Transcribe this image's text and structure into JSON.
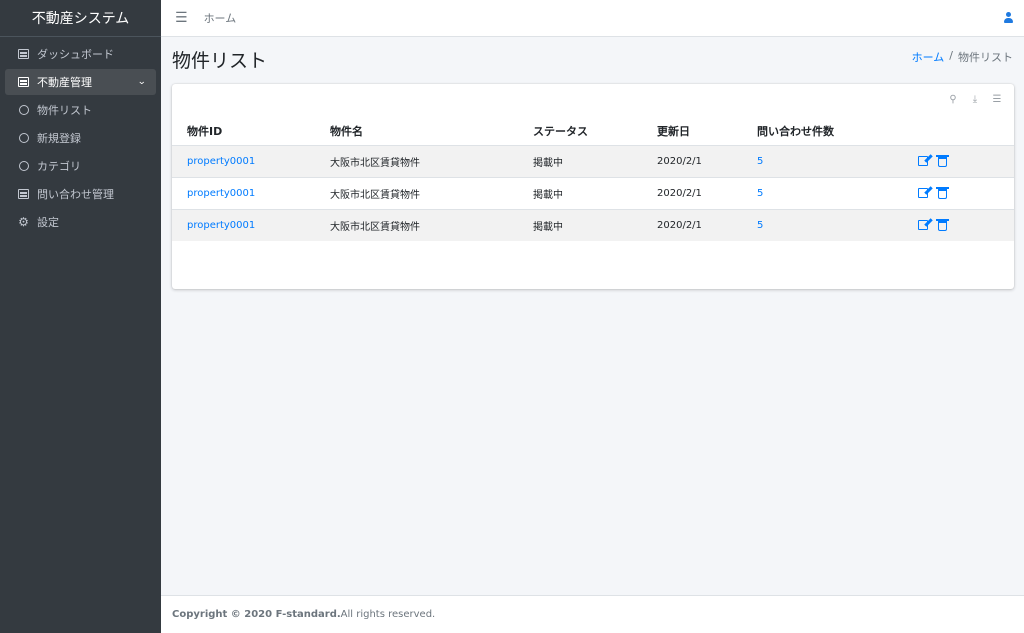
{
  "sidebar": {
    "brand": "不動産システム",
    "items": [
      {
        "label": "ダッシュボード",
        "icon": "list-icon"
      },
      {
        "label": "不動産管理",
        "icon": "list-icon",
        "active": true
      },
      {
        "label": "物件リスト",
        "icon": "circle-icon"
      },
      {
        "label": "新規登録",
        "icon": "circle-icon"
      },
      {
        "label": "カテゴリ",
        "icon": "circle-icon"
      },
      {
        "label": "問い合わせ管理",
        "icon": "list-icon"
      },
      {
        "label": "設定",
        "icon": "gear-icon"
      }
    ]
  },
  "topbar": {
    "home": "ホーム"
  },
  "page": {
    "title": "物件リスト",
    "breadcrumb": {
      "home": "ホーム",
      "sep": "/",
      "current": "物件リスト"
    }
  },
  "table": {
    "headers": [
      "物件ID",
      "物件名",
      "ステータス",
      "更新日",
      "問い合わせ件数"
    ],
    "rows": [
      {
        "id": "property0001",
        "name": "大阪市北区賃貸物件",
        "status": "掲載中",
        "date": "2020/2/1",
        "inquiries": "5"
      },
      {
        "id": "property0001",
        "name": "大阪市北区賃貸物件",
        "status": "掲載中",
        "date": "2020/2/1",
        "inquiries": "5"
      },
      {
        "id": "property0001",
        "name": "大阪市北区賃貸物件",
        "status": "掲載中",
        "date": "2020/2/1",
        "inquiries": "5"
      }
    ]
  },
  "footer": {
    "copyright": "Copyright © 2020 F-standard.",
    "rights": " All rights reserved."
  },
  "colors": {
    "accent": "#007bff",
    "sidebar": "#343a40",
    "user_icon": "#1f7ae0"
  }
}
